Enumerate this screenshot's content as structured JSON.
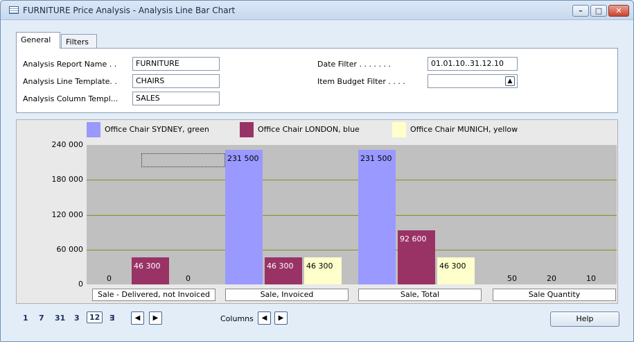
{
  "window": {
    "title": "FURNITURE Price Analysis - Analysis Line Bar Chart"
  },
  "tabs": [
    {
      "label": "General"
    },
    {
      "label": "Filters"
    }
  ],
  "fields": {
    "analysis_report_name": {
      "label": "Analysis Report Name . .",
      "value": "FURNITURE"
    },
    "analysis_line_template": {
      "label": "Analysis Line Template. .",
      "value": "CHAIRS"
    },
    "analysis_column_template": {
      "label": "Analysis Column Templ...",
      "value": "SALES"
    },
    "date_filter": {
      "label": "Date Filter . . . . . . .",
      "value": "01.01.10..31.12.10"
    },
    "item_budget_filter": {
      "label": "Item Budget Filter . . . .",
      "value": ""
    }
  },
  "chart_data": {
    "type": "bar",
    "categories": [
      "Sale - Delivered, not Invoiced",
      "Sale, Invoiced",
      "Sale, Total",
      "Sale Quantity"
    ],
    "series": [
      {
        "name": "Office Chair SYDNEY, green",
        "color": "#9999ff",
        "values": [
          0,
          231500,
          231500,
          50
        ],
        "labels": [
          "0",
          "231 500",
          "231 500",
          "50"
        ]
      },
      {
        "name": "Office Chair LONDON, blue",
        "color": "#993366",
        "values": [
          46300,
          46300,
          92600,
          20
        ],
        "labels": [
          "46 300",
          "46 300",
          "92 600",
          "20"
        ]
      },
      {
        "name": "Office Chair MUNICH, yellow",
        "color": "#ffffcc",
        "values": [
          0,
          46300,
          46300,
          10
        ],
        "labels": [
          "0",
          "46 300",
          "46 300",
          "10"
        ]
      }
    ],
    "yticks": [
      "240 000",
      "180 000",
      "120 000",
      "60 000",
      "0"
    ],
    "ylim": [
      0,
      240000
    ],
    "legend": "top",
    "grid": true
  },
  "bottom": {
    "periods": [
      "1",
      "7",
      "31",
      "3",
      "12",
      "∃"
    ],
    "selected_period": "12",
    "columns_label": "Columns",
    "help_label": "Help"
  }
}
